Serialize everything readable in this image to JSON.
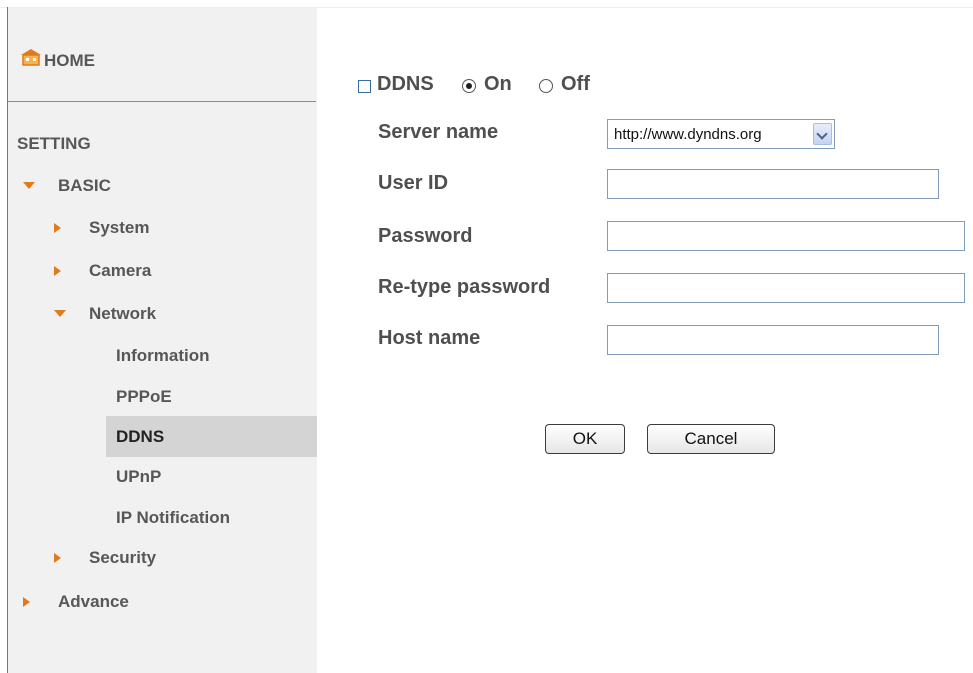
{
  "sidebar": {
    "home_label": "HOME",
    "setting_label": "SETTING",
    "basic_label": "BASIC",
    "system_label": "System",
    "camera_label": "Camera",
    "network_label": "Network",
    "network_items": [
      "Information",
      "PPPoE",
      "DDNS",
      "UPnP",
      "IP Notification"
    ],
    "security_label": "Security",
    "advance_label": "Advance",
    "selected_item": "DDNS"
  },
  "form": {
    "ddns_label": "DDNS",
    "on_label": "On",
    "off_label": "Off",
    "ddns_selected": "On",
    "server_name_label": "Server name",
    "server_name_value": "http://www.dyndns.org",
    "user_id_label": "User ID",
    "user_id_value": "",
    "password_label": "Password",
    "password_value": "",
    "retype_password_label": "Re-type password",
    "retype_password_value": "",
    "host_name_label": "Host name",
    "host_name_value": ""
  },
  "buttons": {
    "ok_label": "OK",
    "cancel_label": "Cancel"
  },
  "colors": {
    "accent": "#e07a1c",
    "sidebar_bg": "#f1f1f1",
    "selected_bg": "#d4d4d4"
  }
}
